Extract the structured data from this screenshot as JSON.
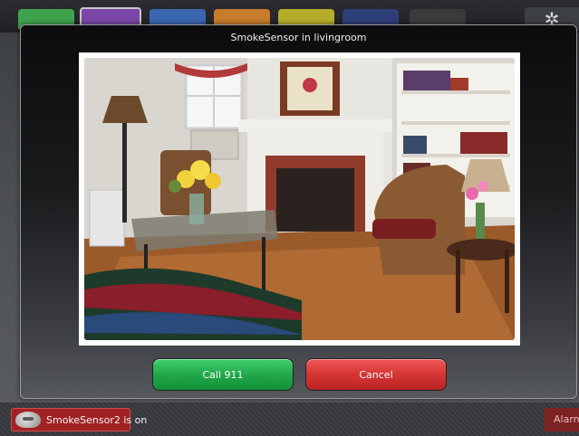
{
  "dialog": {
    "title": "SmokeSensor in livingroom",
    "call_label": "Call 911",
    "cancel_label": "Cancel"
  },
  "status_bar": {
    "notification": "SmokeSensor2 is on",
    "alarm_label": "Alarm"
  },
  "colors": {
    "call_button": "#22a84a",
    "cancel_button": "#d63434",
    "notification_bg": "#a12222"
  },
  "icons": {
    "settings": "gear-icon",
    "sensor": "smoke-sensor-icon"
  }
}
